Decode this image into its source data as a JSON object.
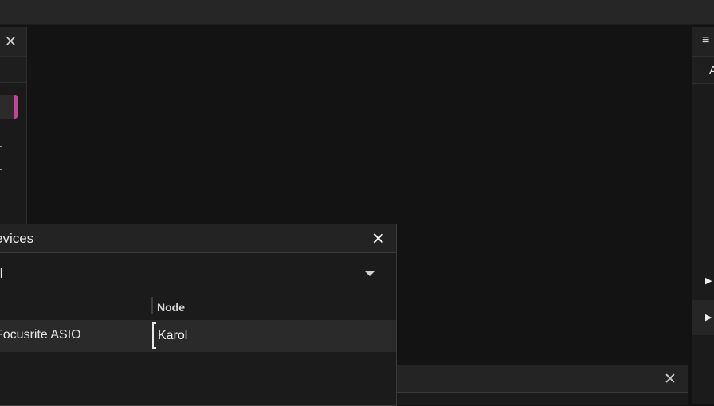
{
  "devices_panel": {
    "title": "evices",
    "close_glyph": "✕",
    "filter_value": "ll",
    "column_header": "Node",
    "rows": [
      {
        "device": "Focusrite ASIO",
        "node": "Karol"
      }
    ]
  },
  "left_panel": {
    "close_glyph": "✕"
  },
  "right_panel": {
    "menu_glyph": "≡",
    "tab_label": "A",
    "arrow_glyph": "▶"
  },
  "bottom_panel": {
    "close_glyph": "✕"
  },
  "colors": {
    "accent": "#c0469a",
    "background": "#131313",
    "panel": "#1b1b1b"
  }
}
